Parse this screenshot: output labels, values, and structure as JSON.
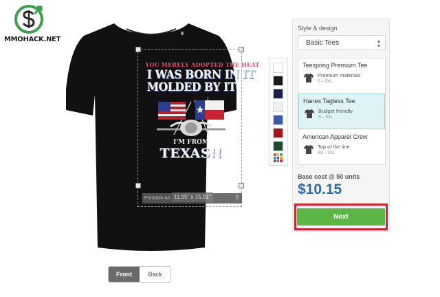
{
  "logo": {
    "text": "MMOHACK.NET"
  },
  "design": {
    "line1": "YOU MERELY ADOPTED THE HEAT",
    "line2": "I WAS BORN IN IT",
    "line3": "MOLDED BY IT",
    "line4": "I'M FROM",
    "line5": "TEXAS!!"
  },
  "printable": {
    "label": "Printable Art",
    "dimensions": "11.95\" x 15.91\""
  },
  "view_toggle": {
    "front": "Front",
    "back": "Back",
    "active": "Front"
  },
  "colors": [
    {
      "name": "white",
      "hex": "#ffffff"
    },
    {
      "name": "black",
      "hex": "#1a1a1a"
    },
    {
      "name": "navy",
      "hex": "#1c2245"
    },
    {
      "name": "light gray",
      "hex": "#eef0f4"
    },
    {
      "name": "royal blue",
      "hex": "#3f58a5"
    },
    {
      "name": "red",
      "hex": "#a3141b"
    },
    {
      "name": "forest green",
      "hex": "#1f4a2d"
    }
  ],
  "panel": {
    "title": "Style & design",
    "style_select": "Basic Tees",
    "products": [
      {
        "name": "Teespring Premium Tee",
        "desc": "Premium materials",
        "sizes": "S – 5XL",
        "selected": false
      },
      {
        "name": "Hanes Tagless Tee",
        "desc": "Budget friendly",
        "sizes": "S – 5XL",
        "selected": true
      },
      {
        "name": "American Apparel Crew",
        "desc": "Top of the line",
        "sizes": "XS – 3XL",
        "selected": false
      }
    ],
    "base_cost_label": "Base cost @ 50 units",
    "base_cost": "$10.15",
    "next_label": "Next"
  },
  "theme": {
    "accent": "#5cb646",
    "price": "#2d6aa8",
    "highlight": "#d1242f",
    "selected_bg": "#dff3f7"
  }
}
